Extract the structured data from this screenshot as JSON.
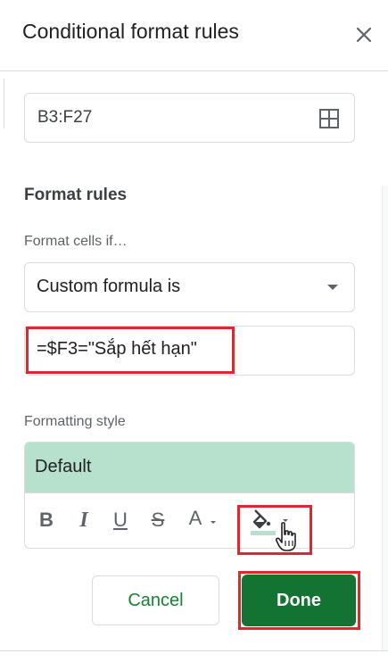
{
  "panel": {
    "title": "Conditional format rules"
  },
  "range": {
    "value": "B3:F27",
    "icon": "grid-icon"
  },
  "format_rules": {
    "section_title": "Format rules",
    "condition_label": "Format cells if…",
    "condition_selected": "Custom formula is",
    "formula_value": "=$F3=\"Sắp hết hạn\""
  },
  "formatting_style": {
    "label": "Formatting style",
    "preview_label": "Default",
    "preview_fill_color": "#b7e1cd",
    "toolbar": {
      "bold": "B",
      "italic": "I",
      "underline": "U",
      "strikethrough": "S",
      "text_color": "A"
    }
  },
  "buttons": {
    "cancel": "Cancel",
    "done": "Done"
  },
  "colors": {
    "accent_green": "#137333",
    "highlight_red": "#e0262f"
  }
}
